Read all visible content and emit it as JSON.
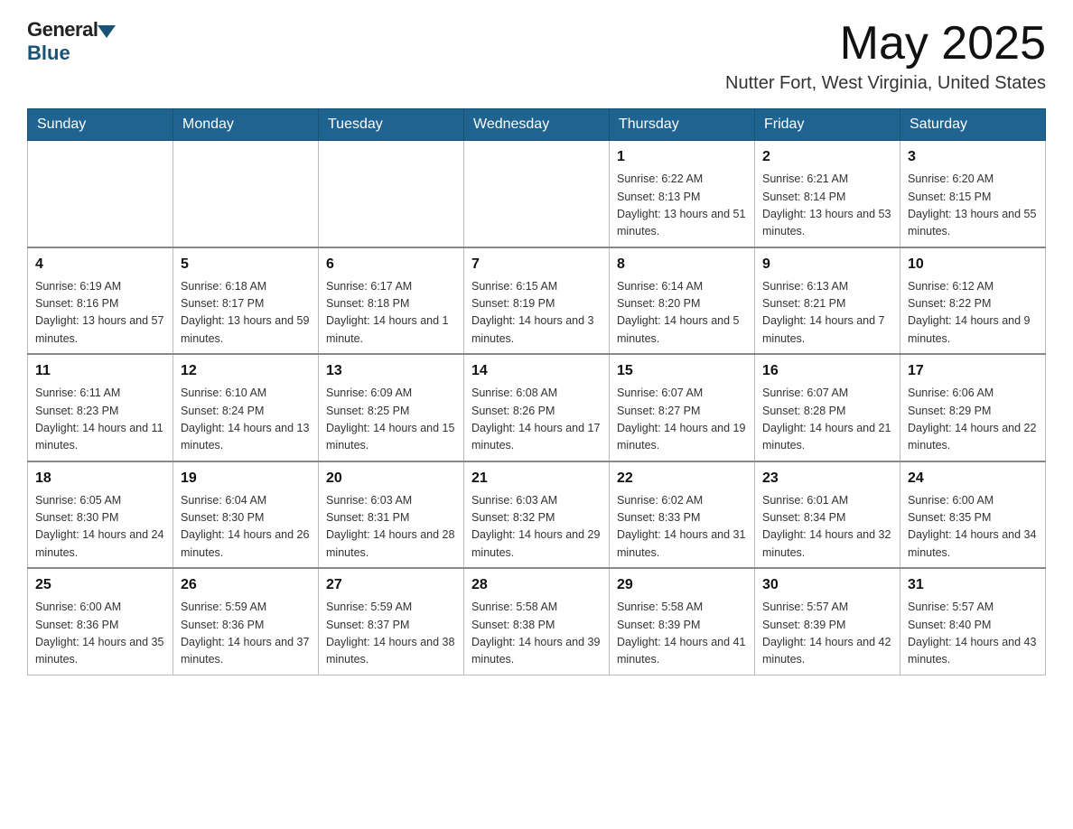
{
  "header": {
    "logo_general": "General",
    "logo_blue": "Blue",
    "title": "May 2025",
    "subtitle": "Nutter Fort, West Virginia, United States"
  },
  "days_of_week": [
    "Sunday",
    "Monday",
    "Tuesday",
    "Wednesday",
    "Thursday",
    "Friday",
    "Saturday"
  ],
  "weeks": [
    [
      {
        "day": "",
        "sunrise": "",
        "sunset": "",
        "daylight": ""
      },
      {
        "day": "",
        "sunrise": "",
        "sunset": "",
        "daylight": ""
      },
      {
        "day": "",
        "sunrise": "",
        "sunset": "",
        "daylight": ""
      },
      {
        "day": "",
        "sunrise": "",
        "sunset": "",
        "daylight": ""
      },
      {
        "day": "1",
        "sunrise": "Sunrise: 6:22 AM",
        "sunset": "Sunset: 8:13 PM",
        "daylight": "Daylight: 13 hours and 51 minutes."
      },
      {
        "day": "2",
        "sunrise": "Sunrise: 6:21 AM",
        "sunset": "Sunset: 8:14 PM",
        "daylight": "Daylight: 13 hours and 53 minutes."
      },
      {
        "day": "3",
        "sunrise": "Sunrise: 6:20 AM",
        "sunset": "Sunset: 8:15 PM",
        "daylight": "Daylight: 13 hours and 55 minutes."
      }
    ],
    [
      {
        "day": "4",
        "sunrise": "Sunrise: 6:19 AM",
        "sunset": "Sunset: 8:16 PM",
        "daylight": "Daylight: 13 hours and 57 minutes."
      },
      {
        "day": "5",
        "sunrise": "Sunrise: 6:18 AM",
        "sunset": "Sunset: 8:17 PM",
        "daylight": "Daylight: 13 hours and 59 minutes."
      },
      {
        "day": "6",
        "sunrise": "Sunrise: 6:17 AM",
        "sunset": "Sunset: 8:18 PM",
        "daylight": "Daylight: 14 hours and 1 minute."
      },
      {
        "day": "7",
        "sunrise": "Sunrise: 6:15 AM",
        "sunset": "Sunset: 8:19 PM",
        "daylight": "Daylight: 14 hours and 3 minutes."
      },
      {
        "day": "8",
        "sunrise": "Sunrise: 6:14 AM",
        "sunset": "Sunset: 8:20 PM",
        "daylight": "Daylight: 14 hours and 5 minutes."
      },
      {
        "day": "9",
        "sunrise": "Sunrise: 6:13 AM",
        "sunset": "Sunset: 8:21 PM",
        "daylight": "Daylight: 14 hours and 7 minutes."
      },
      {
        "day": "10",
        "sunrise": "Sunrise: 6:12 AM",
        "sunset": "Sunset: 8:22 PM",
        "daylight": "Daylight: 14 hours and 9 minutes."
      }
    ],
    [
      {
        "day": "11",
        "sunrise": "Sunrise: 6:11 AM",
        "sunset": "Sunset: 8:23 PM",
        "daylight": "Daylight: 14 hours and 11 minutes."
      },
      {
        "day": "12",
        "sunrise": "Sunrise: 6:10 AM",
        "sunset": "Sunset: 8:24 PM",
        "daylight": "Daylight: 14 hours and 13 minutes."
      },
      {
        "day": "13",
        "sunrise": "Sunrise: 6:09 AM",
        "sunset": "Sunset: 8:25 PM",
        "daylight": "Daylight: 14 hours and 15 minutes."
      },
      {
        "day": "14",
        "sunrise": "Sunrise: 6:08 AM",
        "sunset": "Sunset: 8:26 PM",
        "daylight": "Daylight: 14 hours and 17 minutes."
      },
      {
        "day": "15",
        "sunrise": "Sunrise: 6:07 AM",
        "sunset": "Sunset: 8:27 PM",
        "daylight": "Daylight: 14 hours and 19 minutes."
      },
      {
        "day": "16",
        "sunrise": "Sunrise: 6:07 AM",
        "sunset": "Sunset: 8:28 PM",
        "daylight": "Daylight: 14 hours and 21 minutes."
      },
      {
        "day": "17",
        "sunrise": "Sunrise: 6:06 AM",
        "sunset": "Sunset: 8:29 PM",
        "daylight": "Daylight: 14 hours and 22 minutes."
      }
    ],
    [
      {
        "day": "18",
        "sunrise": "Sunrise: 6:05 AM",
        "sunset": "Sunset: 8:30 PM",
        "daylight": "Daylight: 14 hours and 24 minutes."
      },
      {
        "day": "19",
        "sunrise": "Sunrise: 6:04 AM",
        "sunset": "Sunset: 8:30 PM",
        "daylight": "Daylight: 14 hours and 26 minutes."
      },
      {
        "day": "20",
        "sunrise": "Sunrise: 6:03 AM",
        "sunset": "Sunset: 8:31 PM",
        "daylight": "Daylight: 14 hours and 28 minutes."
      },
      {
        "day": "21",
        "sunrise": "Sunrise: 6:03 AM",
        "sunset": "Sunset: 8:32 PM",
        "daylight": "Daylight: 14 hours and 29 minutes."
      },
      {
        "day": "22",
        "sunrise": "Sunrise: 6:02 AM",
        "sunset": "Sunset: 8:33 PM",
        "daylight": "Daylight: 14 hours and 31 minutes."
      },
      {
        "day": "23",
        "sunrise": "Sunrise: 6:01 AM",
        "sunset": "Sunset: 8:34 PM",
        "daylight": "Daylight: 14 hours and 32 minutes."
      },
      {
        "day": "24",
        "sunrise": "Sunrise: 6:00 AM",
        "sunset": "Sunset: 8:35 PM",
        "daylight": "Daylight: 14 hours and 34 minutes."
      }
    ],
    [
      {
        "day": "25",
        "sunrise": "Sunrise: 6:00 AM",
        "sunset": "Sunset: 8:36 PM",
        "daylight": "Daylight: 14 hours and 35 minutes."
      },
      {
        "day": "26",
        "sunrise": "Sunrise: 5:59 AM",
        "sunset": "Sunset: 8:36 PM",
        "daylight": "Daylight: 14 hours and 37 minutes."
      },
      {
        "day": "27",
        "sunrise": "Sunrise: 5:59 AM",
        "sunset": "Sunset: 8:37 PM",
        "daylight": "Daylight: 14 hours and 38 minutes."
      },
      {
        "day": "28",
        "sunrise": "Sunrise: 5:58 AM",
        "sunset": "Sunset: 8:38 PM",
        "daylight": "Daylight: 14 hours and 39 minutes."
      },
      {
        "day": "29",
        "sunrise": "Sunrise: 5:58 AM",
        "sunset": "Sunset: 8:39 PM",
        "daylight": "Daylight: 14 hours and 41 minutes."
      },
      {
        "day": "30",
        "sunrise": "Sunrise: 5:57 AM",
        "sunset": "Sunset: 8:39 PM",
        "daylight": "Daylight: 14 hours and 42 minutes."
      },
      {
        "day": "31",
        "sunrise": "Sunrise: 5:57 AM",
        "sunset": "Sunset: 8:40 PM",
        "daylight": "Daylight: 14 hours and 43 minutes."
      }
    ]
  ]
}
